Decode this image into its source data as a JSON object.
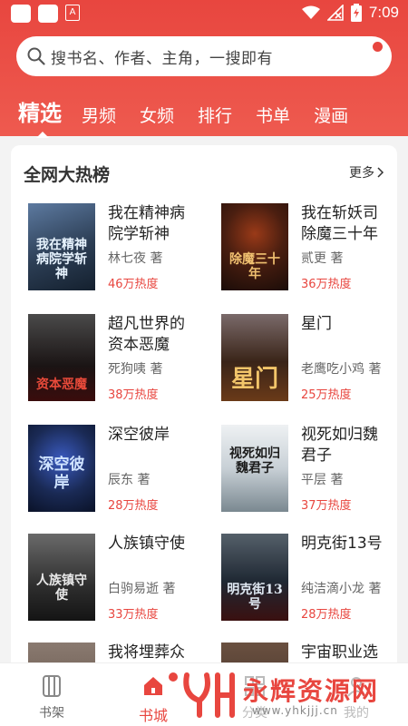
{
  "status_bar": {
    "time": "7:09"
  },
  "search": {
    "placeholder": "搜书名、作者、主角，一搜即有"
  },
  "tabs": [
    "精选",
    "男频",
    "女频",
    "排行",
    "书单",
    "漫画"
  ],
  "section": {
    "title": "全网大热榜",
    "more": "更多"
  },
  "books": [
    {
      "title": "我在精神病院学斩神",
      "author": "林七夜 著",
      "heat": "46万热度",
      "cover_text": "我在精神病院学斩神",
      "cover_bg": "#2c3e55",
      "cover_fg": "#e8f4ff"
    },
    {
      "title": "我在斩妖司除魔三十年",
      "author": "贰更 著",
      "heat": "36万热度",
      "cover_text": "除魔三十年",
      "cover_bg": "#2a160f",
      "cover_fg": "#f0c070"
    },
    {
      "title": "超凡世界的资本恶魔",
      "author": "死狗咦 著",
      "heat": "38万热度",
      "cover_text": "资本恶魔",
      "cover_bg": "#1a1414",
      "cover_fg": "#e84a3a"
    },
    {
      "title": "星门",
      "author": "老鹰吃小鸡 著",
      "heat": "25万热度",
      "cover_text": "星门",
      "cover_bg": "#3a2418",
      "cover_fg": "#f2c56a"
    },
    {
      "title": "深空彼岸",
      "author": "辰东 著",
      "heat": "28万热度",
      "cover_text": "深空彼岸",
      "cover_bg": "#1a2a55",
      "cover_fg": "#cfe3ff"
    },
    {
      "title": "视死如归魏君子",
      "author": "平层 著",
      "heat": "37万热度",
      "cover_text": "视死如归魏君子",
      "cover_bg": "#cfd6db",
      "cover_fg": "#1b1b1b"
    },
    {
      "title": "人族镇守使",
      "author": "白驹易逝 著",
      "heat": "33万热度",
      "cover_text": "人族镇守使",
      "cover_bg": "#2e2e2e",
      "cover_fg": "#e8e8e8"
    },
    {
      "title": "明克街13号",
      "author": "纯洁滴小龙 著",
      "heat": "28万热度",
      "cover_text": "明克街13号",
      "cover_bg": "#1f2833",
      "cover_fg": "#dfe8f2"
    },
    {
      "title": "我将埋葬众神",
      "author": "",
      "heat": "",
      "cover_text": "",
      "cover_bg": "#5a4a40",
      "cover_fg": "#fff"
    },
    {
      "title": "宇宙职业选手",
      "author": "",
      "heat": "",
      "cover_text": "",
      "cover_bg": "#3a2c24",
      "cover_fg": "#fff"
    }
  ],
  "bottom_nav": [
    "书架",
    "书城",
    "分类",
    "我的"
  ],
  "watermark": {
    "name": "永辉资源网",
    "url": "www.yhkjjj.cn"
  },
  "colors": {
    "accent": "#e8463f",
    "header": "#ec5046"
  }
}
